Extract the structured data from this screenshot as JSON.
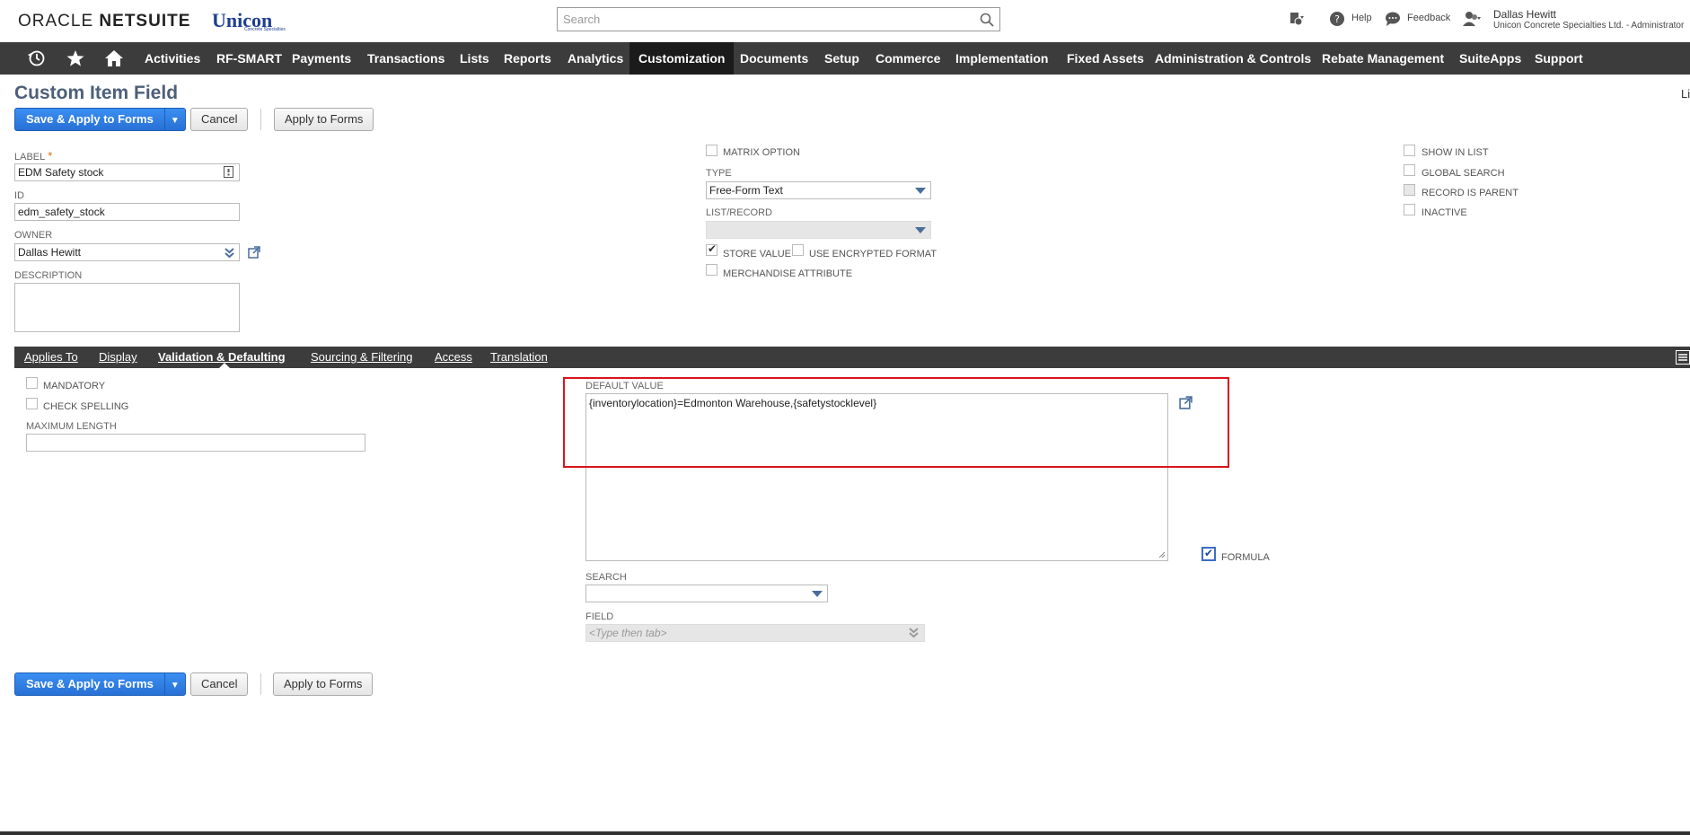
{
  "header": {
    "logo_oracle": "ORACLE",
    "logo_netsuite": "NETSUITE",
    "logo_unicon": "Unicon",
    "logo_unicon_sub": "Concrete Specialties",
    "search_placeholder": "Search",
    "help_label": "Help",
    "feedback_label": "Feedback",
    "user_name": "Dallas Hewitt",
    "user_company": "Unicon Concrete Specialties Ltd. - Administrator"
  },
  "nav": {
    "items": [
      {
        "label": "Activities"
      },
      {
        "label": "RF-SMART"
      },
      {
        "label": "Payments"
      },
      {
        "label": "Transactions"
      },
      {
        "label": "Lists"
      },
      {
        "label": "Reports"
      },
      {
        "label": "Analytics"
      },
      {
        "label": "Customization"
      },
      {
        "label": "Documents"
      },
      {
        "label": "Setup"
      },
      {
        "label": "Commerce"
      },
      {
        "label": "Implementation"
      },
      {
        "label": "Fixed Assets"
      },
      {
        "label": "Administration & Controls"
      },
      {
        "label": "Rebate Management"
      },
      {
        "label": "SuiteApps"
      },
      {
        "label": "Support"
      }
    ],
    "active": "Customization"
  },
  "page": {
    "title": "Custom Item Field",
    "right_edge_text": "Li"
  },
  "buttons": {
    "save_apply": "Save & Apply to Forms",
    "cancel": "Cancel",
    "apply_forms": "Apply to Forms"
  },
  "form": {
    "label_label": "LABEL",
    "label_value": "EDM Safety stock",
    "id_label": "ID",
    "id_value": "edm_safety_stock",
    "owner_label": "OWNER",
    "owner_value": "Dallas Hewitt",
    "description_label": "DESCRIPTION",
    "matrix_option": "MATRIX OPTION",
    "type_label": "TYPE",
    "type_value": "Free-Form Text",
    "list_record_label": "LIST/RECORD",
    "store_value": "STORE VALUE",
    "use_encrypted": "USE ENCRYPTED FORMAT",
    "merchandise_attr": "MERCHANDISE ATTRIBUTE",
    "show_in_list": "SHOW IN LIST",
    "global_search": "GLOBAL SEARCH",
    "record_is_parent": "RECORD IS PARENT",
    "inactive": "INACTIVE"
  },
  "tabs": {
    "items": [
      {
        "label": "Applies To"
      },
      {
        "label": "Display"
      },
      {
        "label": "Validation & Defaulting"
      },
      {
        "label": "Sourcing & Filtering"
      },
      {
        "label": "Access"
      },
      {
        "label": "Translation"
      }
    ],
    "active": "Validation & Defaulting"
  },
  "validation": {
    "mandatory": "MANDATORY",
    "check_spelling": "CHECK SPELLING",
    "max_length_label": "MAXIMUM LENGTH",
    "default_value_label": "DEFAULT VALUE",
    "default_value": "{inventorylocation}=Edmonton Warehouse,{safetystocklevel}",
    "formula_label": "FORMULA",
    "search_label": "SEARCH",
    "field_label": "FIELD",
    "field_placeholder": "<Type then tab>"
  },
  "colors": {
    "nav_bg": "#3c3c3c",
    "primary_button": "#2870d6",
    "title": "#4d5f79",
    "highlight": "#d8151c"
  }
}
